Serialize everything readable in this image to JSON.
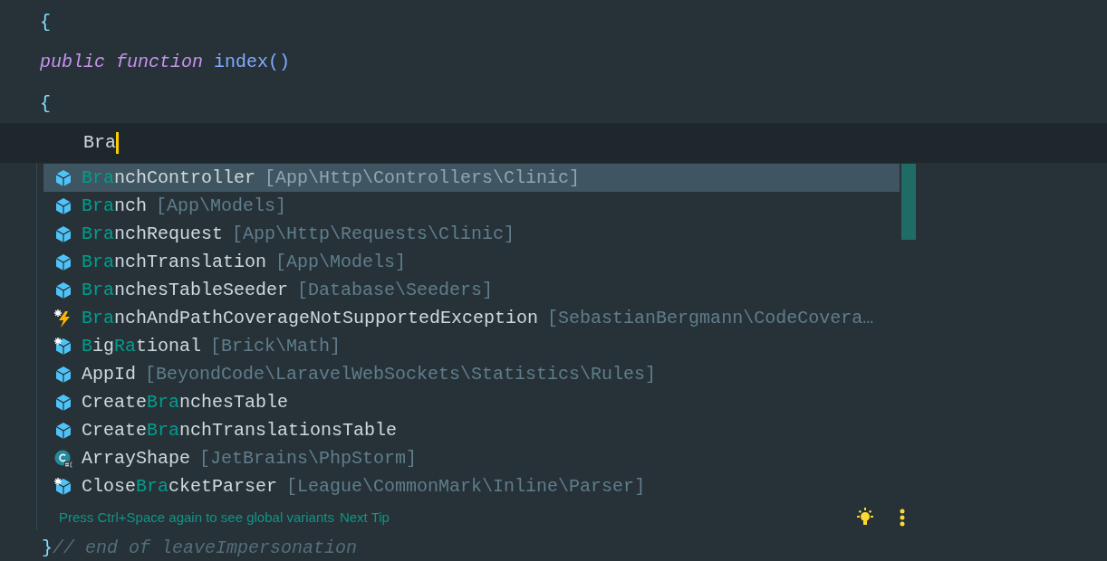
{
  "editor": {
    "lines": [
      {
        "current": false,
        "segments": [
          {
            "kind": "brace",
            "text": "{"
          }
        ]
      },
      {
        "current": false,
        "segments": [
          {
            "kind": "keyword",
            "text": "public function"
          },
          {
            "kind": "function",
            "text": " index()"
          }
        ]
      },
      {
        "current": false,
        "segments": [
          {
            "kind": "brace",
            "text": "{"
          }
        ]
      },
      {
        "current": true,
        "segments": [
          {
            "kind": "text",
            "text": "Bra"
          }
        ]
      }
    ],
    "closing_line": {
      "segments": [
        {
          "kind": "brace",
          "text": "}"
        },
        {
          "kind": "comment",
          "text": "// end of leaveImpersonation"
        }
      ]
    }
  },
  "completion_popup": {
    "items": [
      {
        "kind": "class",
        "selected": true,
        "name": [
          {
            "text": "Bra",
            "match": true
          },
          {
            "text": "nchController",
            "match": false
          }
        ],
        "namespace": "[App\\Http\\Controllers\\Clinic]"
      },
      {
        "kind": "class",
        "selected": false,
        "name": [
          {
            "text": "Bra",
            "match": true
          },
          {
            "text": "nch",
            "match": false
          }
        ],
        "namespace": "[App\\Models]"
      },
      {
        "kind": "class",
        "selected": false,
        "name": [
          {
            "text": "Bra",
            "match": true
          },
          {
            "text": "nchRequest",
            "match": false
          }
        ],
        "namespace": "[App\\Http\\Requests\\Clinic]"
      },
      {
        "kind": "class",
        "selected": false,
        "name": [
          {
            "text": "Bra",
            "match": true
          },
          {
            "text": "nchTranslation",
            "match": false
          }
        ],
        "namespace": "[App\\Models]"
      },
      {
        "kind": "class",
        "selected": false,
        "name": [
          {
            "text": "Bra",
            "match": true
          },
          {
            "text": "nchesTableSeeder",
            "match": false
          }
        ],
        "namespace": "[Database\\Seeders]"
      },
      {
        "kind": "exception",
        "selected": false,
        "name": [
          {
            "text": "Bra",
            "match": true
          },
          {
            "text": "nchAndPathCoverageNotSupportedException",
            "match": false
          }
        ],
        "namespace": "[SebastianBergmann\\CodeCovera…"
      },
      {
        "kind": "static-class",
        "selected": false,
        "name": [
          {
            "text": "B",
            "match": true
          },
          {
            "text": "ig",
            "match": false
          },
          {
            "text": "Ra",
            "match": true
          },
          {
            "text": "tional",
            "match": false
          }
        ],
        "namespace": "[Brick\\Math]"
      },
      {
        "kind": "class",
        "selected": false,
        "name": [
          {
            "text": "AppId",
            "match": false
          }
        ],
        "namespace": "[BeyondCode\\LaravelWebSockets\\Statistics\\Rules]"
      },
      {
        "kind": "class",
        "selected": false,
        "name": [
          {
            "text": "Create",
            "match": false
          },
          {
            "text": "Bra",
            "match": true
          },
          {
            "text": "nchesTable",
            "match": false
          }
        ]
      },
      {
        "kind": "class",
        "selected": false,
        "name": [
          {
            "text": "Create",
            "match": false
          },
          {
            "text": "Bra",
            "match": true
          },
          {
            "text": "nchTranslationsTable",
            "match": false
          }
        ]
      },
      {
        "kind": "attribute",
        "selected": false,
        "name": [
          {
            "text": "ArrayShape",
            "match": false
          }
        ],
        "namespace": "[JetBrains\\PhpStorm]"
      },
      {
        "kind": "static-class",
        "selected": false,
        "name": [
          {
            "text": "Close",
            "match": false
          },
          {
            "text": "Bra",
            "match": true
          },
          {
            "text": "cketParser",
            "match": false
          }
        ],
        "namespace": "[League\\CommonMark\\Inline\\Parser]"
      }
    ],
    "hint": "Press Ctrl+Space again to see global variants",
    "next_tip": "Next Tip"
  }
}
